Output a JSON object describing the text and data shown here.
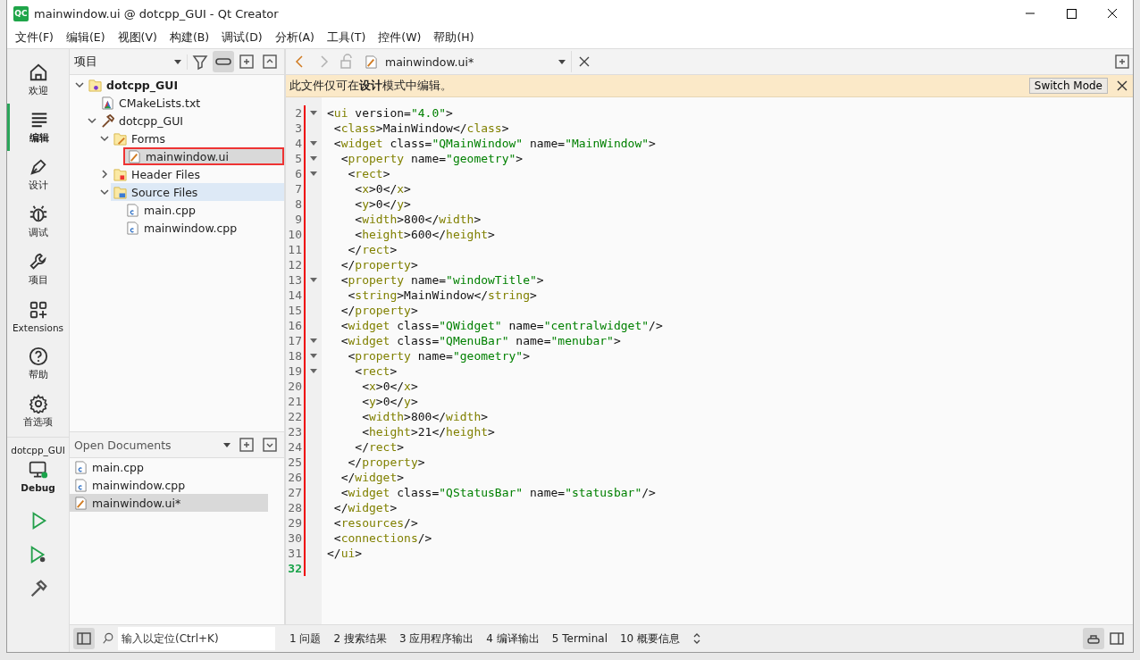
{
  "window": {
    "logo": "QC",
    "title": "mainwindow.ui @ dotcpp_GUI - Qt Creator"
  },
  "menu": [
    "文件(F)",
    "编辑(E)",
    "视图(V)",
    "构建(B)",
    "调试(D)",
    "分析(A)",
    "工具(T)",
    "控件(W)",
    "帮助(H)"
  ],
  "modes": [
    {
      "kind": "home",
      "label": "欢迎",
      "selected": false
    },
    {
      "kind": "edit",
      "label": "编辑",
      "selected": true
    },
    {
      "kind": "design",
      "label": "设计",
      "selected": false
    },
    {
      "kind": "debug",
      "label": "调试",
      "selected": false
    },
    {
      "kind": "project",
      "label": "项目",
      "selected": false
    },
    {
      "kind": "extensions",
      "label": "Extensions",
      "selected": false
    },
    {
      "kind": "help",
      "label": "帮助",
      "selected": false
    },
    {
      "kind": "settings",
      "label": "首选项",
      "selected": false
    }
  ],
  "kit": {
    "project": "dotcpp_GUI",
    "label": "Debug"
  },
  "navigator": {
    "view": "项目",
    "sync_on": true,
    "tree": [
      {
        "name": "dotcpp_GUI",
        "kind": "project",
        "bold": true,
        "expanded": true,
        "selected": false,
        "children": [
          {
            "name": "CMakeLists.txt",
            "kind": "cmake",
            "selected": false
          },
          {
            "name": "dotcpp_GUI",
            "kind": "target",
            "expanded": true,
            "selected": false,
            "children": [
              {
                "name": "Forms",
                "kind": "forms",
                "expanded": true,
                "selected": false,
                "children": [
                  {
                    "name": "mainwindow.ui",
                    "kind": "ui",
                    "selected": true,
                    "annotated": true
                  }
                ]
              },
              {
                "name": "Header Files",
                "kind": "headers",
                "expanded": false,
                "selected": false
              },
              {
                "name": "Source Files",
                "kind": "sources",
                "expanded": true,
                "hovered": true,
                "selected": false,
                "children": [
                  {
                    "name": "main.cpp",
                    "kind": "cpp",
                    "selected": false
                  },
                  {
                    "name": "mainwindow.cpp",
                    "kind": "cpp",
                    "selected": false
                  }
                ]
              }
            ]
          }
        ]
      }
    ]
  },
  "open_documents": {
    "title": "Open Documents",
    "items": [
      {
        "name": "main.cpp",
        "kind": "cpp",
        "selected": false
      },
      {
        "name": "mainwindow.cpp",
        "kind": "cpp",
        "selected": false
      },
      {
        "name": "mainwindow.ui*",
        "kind": "ui",
        "selected": true
      }
    ]
  },
  "editor": {
    "file": "mainwindow.ui*",
    "info_bar": {
      "message": "此文件仅可在**设计**模式中编辑。",
      "button": "Switch Mode"
    },
    "lines": [
      {
        "number": "2",
        "text": "<ui version=\"4.0\">",
        "fold": true,
        "current": false
      },
      {
        "number": "3",
        "text": " <class>MainWindow</class>",
        "fold": false,
        "current": false
      },
      {
        "number": "4",
        "text": " <widget class=\"QMainWindow\" name=\"MainWindow\">",
        "fold": true,
        "current": false
      },
      {
        "number": "5",
        "text": "  <property name=\"geometry\">",
        "fold": true,
        "current": false
      },
      {
        "number": "6",
        "text": "   <rect>",
        "fold": true,
        "current": false
      },
      {
        "number": "7",
        "text": "    <x>0</x>",
        "fold": false,
        "current": false
      },
      {
        "number": "8",
        "text": "    <y>0</y>",
        "fold": false,
        "current": false
      },
      {
        "number": "9",
        "text": "    <width>800</width>",
        "fold": false,
        "current": false
      },
      {
        "number": "10",
        "text": "    <height>600</height>",
        "fold": false,
        "current": false
      },
      {
        "number": "11",
        "text": "   </rect>",
        "fold": false,
        "current": false
      },
      {
        "number": "12",
        "text": "  </property>",
        "fold": false,
        "current": false
      },
      {
        "number": "13",
        "text": "  <property name=\"windowTitle\">",
        "fold": true,
        "current": false
      },
      {
        "number": "14",
        "text": "   <string>MainWindow</string>",
        "fold": false,
        "current": false
      },
      {
        "number": "15",
        "text": "  </property>",
        "fold": false,
        "current": false
      },
      {
        "number": "16",
        "text": "  <widget class=\"QWidget\" name=\"centralwidget\"/>",
        "fold": false,
        "current": false
      },
      {
        "number": "17",
        "text": "  <widget class=\"QMenuBar\" name=\"menubar\">",
        "fold": true,
        "current": false
      },
      {
        "number": "18",
        "text": "   <property name=\"geometry\">",
        "fold": true,
        "current": false
      },
      {
        "number": "19",
        "text": "    <rect>",
        "fold": true,
        "current": false
      },
      {
        "number": "20",
        "text": "     <x>0</x>",
        "fold": false,
        "current": false
      },
      {
        "number": "21",
        "text": "     <y>0</y>",
        "fold": false,
        "current": false
      },
      {
        "number": "22",
        "text": "     <width>800</width>",
        "fold": false,
        "current": false
      },
      {
        "number": "23",
        "text": "     <height>21</height>",
        "fold": false,
        "current": false
      },
      {
        "number": "24",
        "text": "    </rect>",
        "fold": false,
        "current": false
      },
      {
        "number": "25",
        "text": "   </property>",
        "fold": false,
        "current": false
      },
      {
        "number": "26",
        "text": "  </widget>",
        "fold": false,
        "current": false
      },
      {
        "number": "27",
        "text": "  <widget class=\"QStatusBar\" name=\"statusbar\"/>",
        "fold": false,
        "current": false
      },
      {
        "number": "28",
        "text": " </widget>",
        "fold": false,
        "current": false
      },
      {
        "number": "29",
        "text": " <resources/>",
        "fold": false,
        "current": false
      },
      {
        "number": "30",
        "text": " <connections/>",
        "fold": false,
        "current": false
      },
      {
        "number": "31",
        "text": "</ui>",
        "fold": false,
        "current": false
      },
      {
        "number": "32",
        "fold": false,
        "current": true
      }
    ]
  },
  "status_bar": {
    "locator": {
      "placeholder": "输入以定位(Ctrl+K)"
    },
    "panes": [
      "1  问题",
      "2  搜索结果",
      "3  应用程序输出",
      "4  编译输出",
      "5  Terminal",
      "10  概要信息"
    ]
  }
}
